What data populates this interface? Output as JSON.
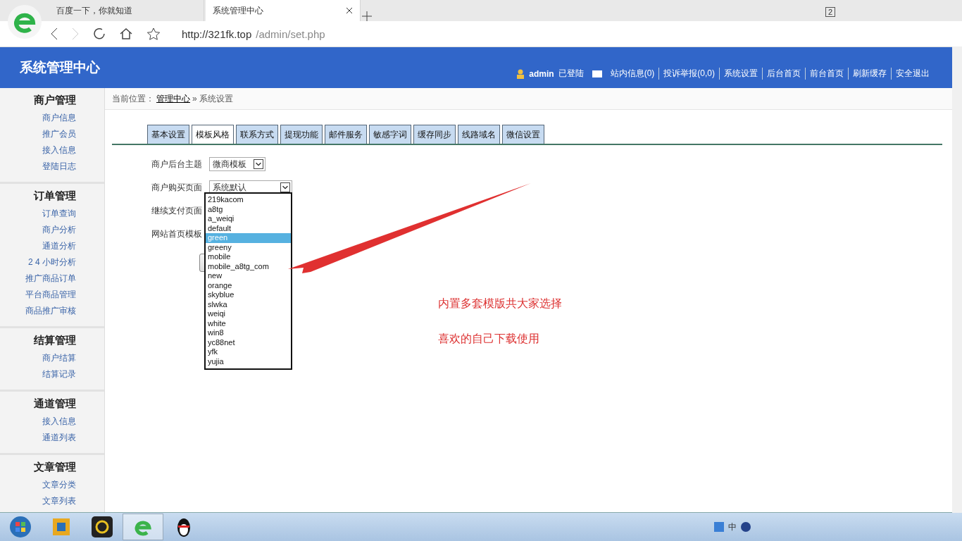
{
  "browser": {
    "tabs": [
      {
        "title": "百度一下，你就知道",
        "selected": false
      },
      {
        "title": "系统管理中心",
        "selected": true
      }
    ],
    "tab_count": "2",
    "url_host": "http://321fk.top",
    "url_path": "/admin/set.php"
  },
  "header": {
    "title": "系统管理中心",
    "user": "admin",
    "status": "已登陆",
    "links": [
      "站内信息(0)",
      "投诉举报(0,0)",
      "系统设置",
      "后台首页",
      "前台首页",
      "刷新缓存",
      "安全退出"
    ]
  },
  "sidebar": [
    {
      "title": "商户管理",
      "items": [
        "商户信息",
        "推广会员",
        "接入信息",
        "登陆日志"
      ]
    },
    {
      "title": "订单管理",
      "items": [
        "订单查询",
        "商户分析",
        "通道分析",
        "2 4 小时分析",
        "推广商品订单",
        "平台商品管理",
        "商品推广审核"
      ]
    },
    {
      "title": "结算管理",
      "items": [
        "商户结算",
        "结算记录"
      ]
    },
    {
      "title": "通道管理",
      "items": [
        "接入信息",
        "通道列表"
      ]
    },
    {
      "title": "文章管理",
      "items": [
        "文章分类",
        "文章列表"
      ]
    }
  ],
  "breadcrumb": {
    "label": "当前位置：",
    "link": "管理中心",
    "separator": "»",
    "current": "系统设置"
  },
  "tabs": [
    {
      "label": "基本设置",
      "selected": false
    },
    {
      "label": "模板风格",
      "selected": true
    },
    {
      "label": "联系方式",
      "selected": false
    },
    {
      "label": "提现功能",
      "selected": false
    },
    {
      "label": "邮件服务",
      "selected": false
    },
    {
      "label": "敏感字词",
      "selected": false
    },
    {
      "label": "缓存同步",
      "selected": false
    },
    {
      "label": "线路域名",
      "selected": false
    },
    {
      "label": "微信设置",
      "selected": false
    }
  ],
  "form": [
    {
      "label": "商户后台主题",
      "value": "微商模板"
    },
    {
      "label": "商户购买页面",
      "value": "系统默认"
    },
    {
      "label": "继续支付页面"
    },
    {
      "label": "网站首页模板"
    }
  ],
  "dropdown": [
    {
      "label": "219kacom",
      "selected": false
    },
    {
      "label": "a8tg",
      "selected": false
    },
    {
      "label": "a_weiqi",
      "selected": false
    },
    {
      "label": "default",
      "selected": false
    },
    {
      "label": "green",
      "selected": true
    },
    {
      "label": "greeny",
      "selected": false
    },
    {
      "label": "mobile",
      "selected": false
    },
    {
      "label": "mobile_a8tg_com",
      "selected": false
    },
    {
      "label": "new",
      "selected": false
    },
    {
      "label": "orange",
      "selected": false
    },
    {
      "label": "skyblue",
      "selected": false
    },
    {
      "label": "slwka",
      "selected": false
    },
    {
      "label": "weiqi",
      "selected": false
    },
    {
      "label": "white",
      "selected": false
    },
    {
      "label": "win8",
      "selected": false
    },
    {
      "label": "yc88net",
      "selected": false
    },
    {
      "label": "yfk",
      "selected": false
    },
    {
      "label": "yujia",
      "selected": false
    }
  ],
  "annotation": [
    "内置多套模版共大家选择",
    "喜欢的自己下载使用"
  ],
  "tray_text": "中"
}
